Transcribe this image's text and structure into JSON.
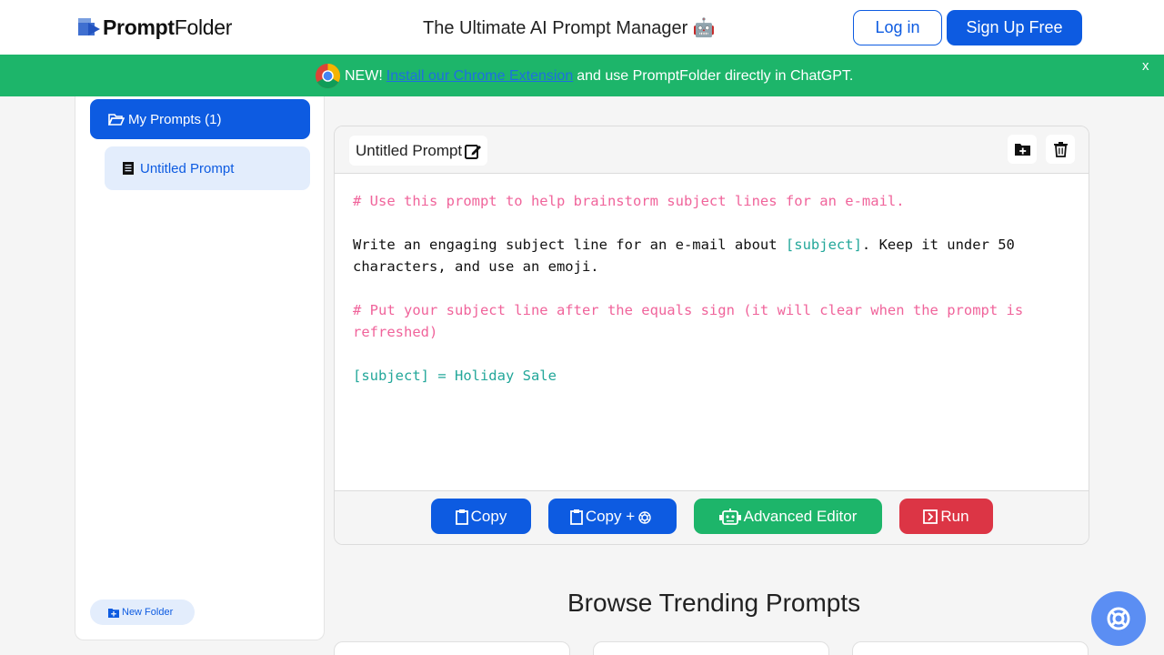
{
  "header": {
    "logo_bold": "Prompt",
    "logo_light": "Folder",
    "tagline": "The Ultimate AI Prompt Manager 🤖",
    "login_label": "Log in",
    "signup_label": "Sign Up Free"
  },
  "banner": {
    "prefix": "NEW!",
    "link_text": "Install our Chrome Extension",
    "suffix": "and use PromptFolder directly in ChatGPT.",
    "close": "x",
    "icon": "chrome-icon"
  },
  "sidebar": {
    "folder_label": "My Prompts (1)",
    "prompt_label": "Untitled Prompt",
    "new_folder_label": "New Folder"
  },
  "editor": {
    "title": "Untitled Prompt",
    "lines": [
      {
        "segments": [
          {
            "text": "# Use this prompt to help brainstorm subject lines for an e-mail.",
            "style": "pink"
          }
        ]
      },
      {
        "segments": [
          {
            "text": "",
            "style": "black"
          }
        ]
      },
      {
        "segments": [
          {
            "text": "Write an engaging subject line for an e-mail about ",
            "style": "black"
          },
          {
            "text": "[subject]",
            "style": "teal"
          },
          {
            "text": ". Keep it under 50 characters, and use an emoji.",
            "style": "black"
          }
        ]
      },
      {
        "segments": [
          {
            "text": "",
            "style": "black"
          }
        ]
      },
      {
        "segments": [
          {
            "text": "# Put your subject line after the equals sign (it will clear when the prompt is refreshed)",
            "style": "pink"
          }
        ]
      },
      {
        "segments": [
          {
            "text": "",
            "style": "black"
          }
        ]
      },
      {
        "segments": [
          {
            "text": "[subject] = Holiday Sale",
            "style": "teal"
          }
        ]
      }
    ],
    "buttons": {
      "copy": "Copy",
      "copy_gpt": "Copy +",
      "advanced": "Advanced Editor",
      "run": "Run"
    }
  },
  "trending": {
    "title": "Browse Trending Prompts"
  },
  "colors": {
    "primary": "#0d5be1",
    "success": "#1db56a",
    "danger": "#dc3545",
    "comment": "#f0649b",
    "variable": "#23a79a"
  }
}
